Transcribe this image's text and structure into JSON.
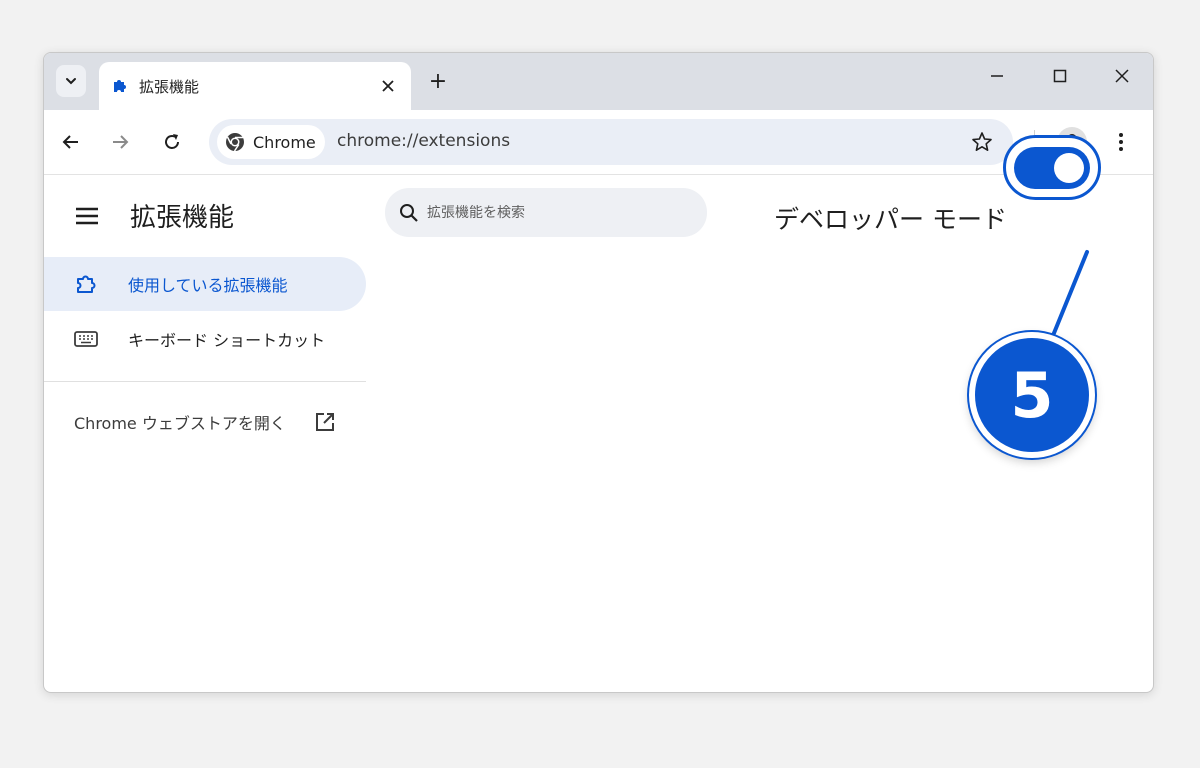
{
  "tab": {
    "title": "拡張機能",
    "new_tab": "+"
  },
  "toolbar": {
    "chip_label": "Chrome",
    "url": "chrome://extensions"
  },
  "sidebar": {
    "title": "拡張機能",
    "items": [
      {
        "label": "使用している拡張機能",
        "icon": "extension-icon",
        "active": true
      },
      {
        "label": "キーボード ショートカット",
        "icon": "keyboard-icon",
        "active": false
      }
    ],
    "store_link": "Chrome ウェブストアを開く"
  },
  "search": {
    "placeholder": "拡張機能を検索"
  },
  "developer_mode": {
    "label": "デベロッパー モード",
    "enabled": true
  },
  "callout": {
    "number": "5"
  },
  "colors": {
    "accent": "#0b57d0",
    "active_nav_bg": "#e7edf8",
    "tabstrip": "#dcdfe5"
  }
}
